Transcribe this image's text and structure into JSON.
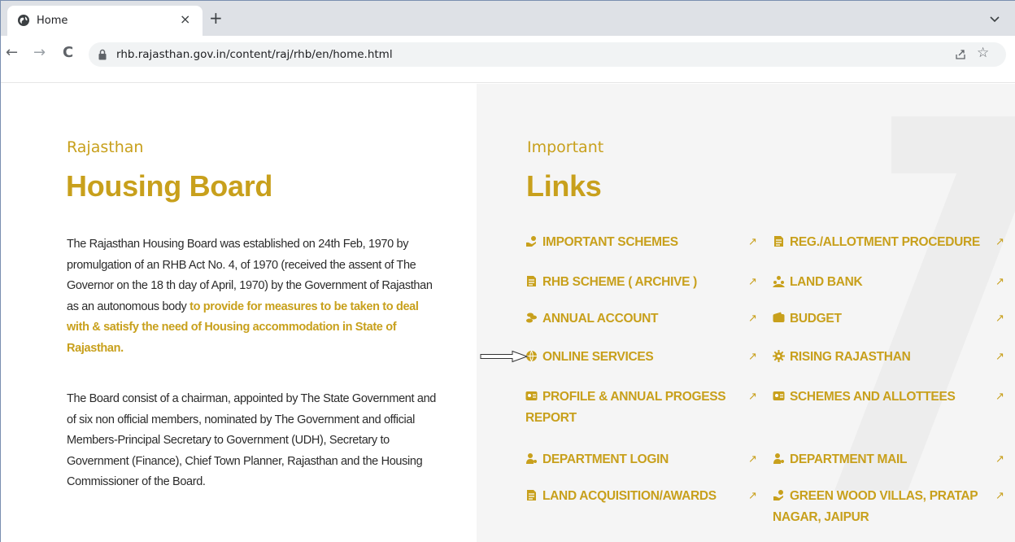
{
  "browser": {
    "tab_title": "Home",
    "tab_close": "×",
    "new_tab": "+",
    "url": "rhb.rajasthan.gov.in/content/raj/rhb/en/home.html",
    "back": "←",
    "forward": "→",
    "reload": "C",
    "bookmark": "☆"
  },
  "about": {
    "kicker": "Rajasthan",
    "heading": "Housing Board",
    "para1_plain": "The Rajasthan Housing Board was established on 24th Feb, 1970 by promulgation of an RHB Act No. 4, of 1970 (received the assent of The Governor on the 18 th day of April, 1970) by the Government of Rajasthan as an autonomous body ",
    "para1_highlight": "to provide for measures to be taken to deal with & satisfy the need of Housing accommodation in State of Rajasthan.",
    "para2": "The Board consist of a chairman, appointed by The State Government and of six non official members, nominated by The Government and official Members-Principal Secretary to Government (UDH), Secretary to Government (Finance), Chief Town Planner, Rajasthan and the Housing Commissioner of the Board."
  },
  "links": {
    "kicker": "Important",
    "heading": "Links",
    "arrow": "↗",
    "left": [
      {
        "label": "IMPORTANT SCHEMES",
        "icon": "money-hand-icon"
      },
      {
        "label": "RHB SCHEME ( ARCHIVE )",
        "icon": "document-icon"
      },
      {
        "label": "ANNUAL ACCOUNT",
        "icon": "coins-icon"
      },
      {
        "label": "ONLINE SERVICES",
        "icon": "globe-icon"
      },
      {
        "label": "PROFILE & ANNUAL PROGESS REPORT",
        "icon": "id-card-icon"
      },
      {
        "label": "DEPARTMENT LOGIN",
        "icon": "user-key-icon"
      },
      {
        "label": "LAND ACQUISITION/AWARDS",
        "icon": "document-icon"
      }
    ],
    "right": [
      {
        "label": "REG./ALLOTMENT PROCEDURE",
        "icon": "document-icon"
      },
      {
        "label": "LAND BANK",
        "icon": "users-icon"
      },
      {
        "label": "BUDGET",
        "icon": "wallet-icon"
      },
      {
        "label": "RISING RAJASTHAN",
        "icon": "settings-icon"
      },
      {
        "label": "SCHEMES AND ALLOTTEES",
        "icon": "id-card-icon"
      },
      {
        "label": "DEPARTMENT MAIL",
        "icon": "user-key-icon"
      },
      {
        "label": "GREEN WOOD VILLAS, PRATAP NAGAR, JAIPUR",
        "icon": "money-hand-icon"
      }
    ]
  },
  "colors": {
    "accent": "#c8a01c",
    "text": "#2b2b2b",
    "right_panel_bg": "#f5f5f5"
  }
}
